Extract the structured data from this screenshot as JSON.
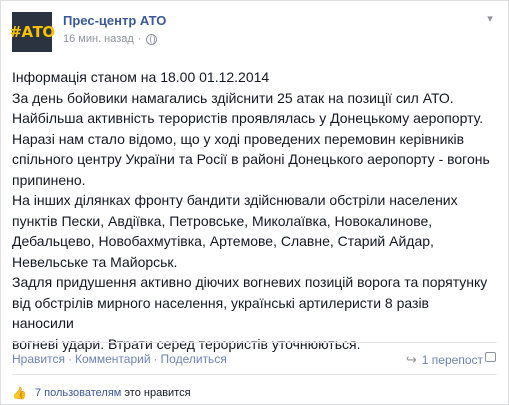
{
  "post": {
    "author": "Прес-центр АТО",
    "avatar_text": "#АТО",
    "timestamp": "16 мин. назад",
    "privacy_icon": "globe-icon",
    "menu_icon": "chevron-down-icon",
    "body": "Інформація станом на 18.00 01.12.2014\nЗа день бойовики намагались здійснити 25 атак на позиції сил АТО.\nНайбільша активність терористів проявлялась у Донецькому аеропорту.\nНаразі нам стало відомо, що у ході проведених перемовин керівників\nспільного центру України та Росії в районі Донецького аеропорту - вогонь\nприпинено.\nНа інших ділянках фронту бандити здійснювали обстріли населених\nпунктів Пески, Авдіївка, Петровське, Миколаївка, Новокалинове,\nДебальцево, Новобахмутівка, Артемове, Славне, Старий Айдар,\nНевельське та Майорськ.\nЗадля придушення активно діючих вогневих позицій ворога та порятунку\nвід обстрілів мирного населення, українські артилеристи 8 разів наносили\nвогневі удари. Втрати серед терористів уточнюються."
  },
  "actions": {
    "like": "Нравится",
    "comment": "Комментарий",
    "share": "Поделиться",
    "separator": "·",
    "reposts": "1 перепост"
  },
  "likes": {
    "count_link": "7 пользователям",
    "rest": "это нравится"
  }
}
